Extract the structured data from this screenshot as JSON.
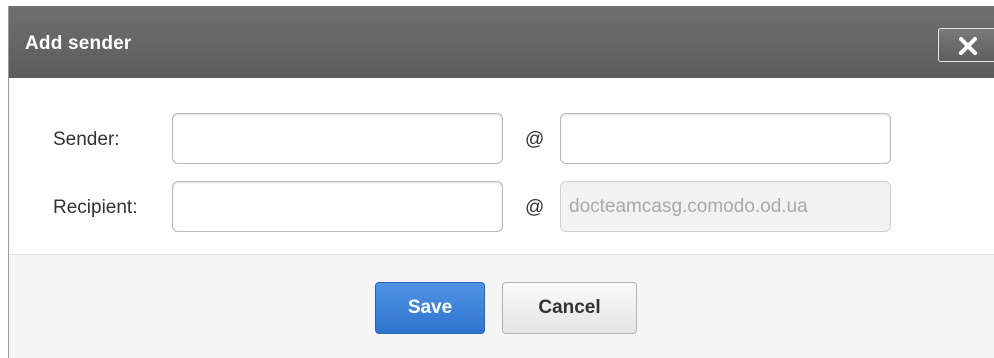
{
  "dialog": {
    "title": "Add sender",
    "close_icon": "close-icon"
  },
  "form": {
    "sender_label": "Sender:",
    "sender_local_value": "",
    "sender_at": "@",
    "sender_domain_value": "",
    "recipient_label": "Recipient:",
    "recipient_local_value": "",
    "recipient_at": "@",
    "recipient_domain_value": "docteamcasg.comodo.od.ua"
  },
  "buttons": {
    "save_label": "Save",
    "cancel_label": "Cancel"
  },
  "colors": {
    "titlebar": "#666666",
    "save_button": "#3a7fd6",
    "footer_bg": "#f5f5f5"
  }
}
